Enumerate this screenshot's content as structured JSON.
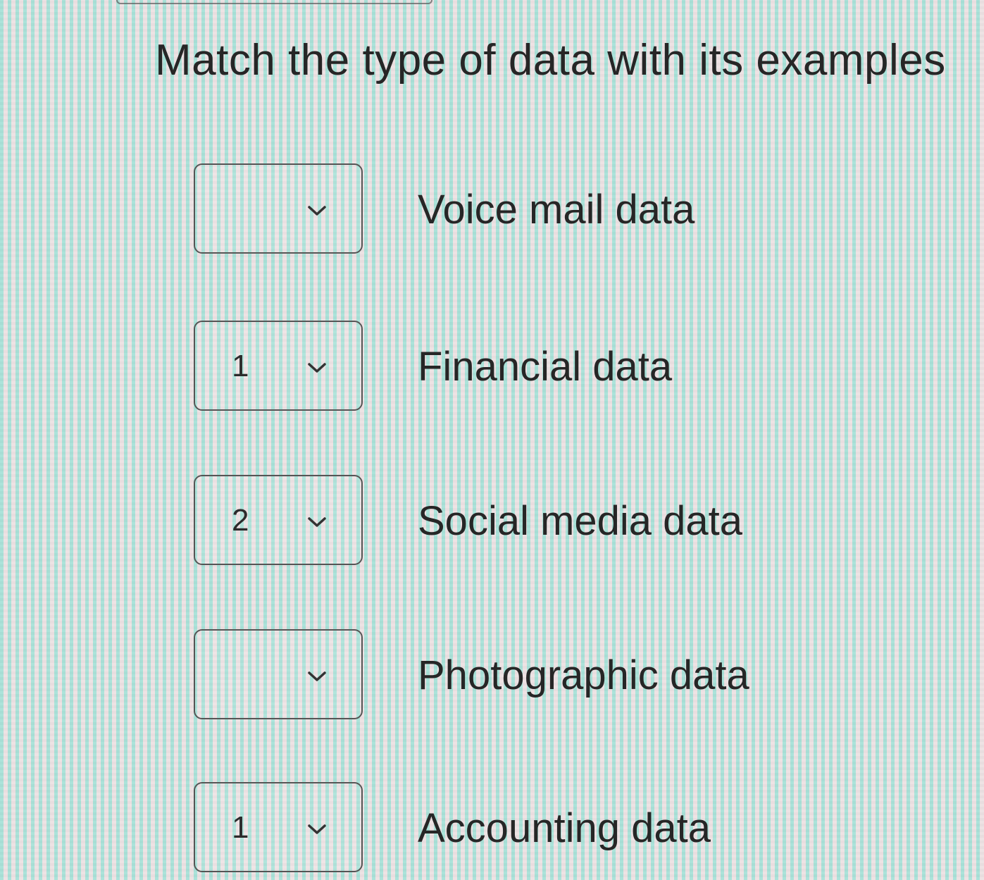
{
  "question": {
    "title": "Match the type of data with its examples"
  },
  "rows": [
    {
      "selected": "",
      "label": "Voice mail data"
    },
    {
      "selected": "1",
      "label": "Financial data"
    },
    {
      "selected": "2",
      "label": "Social media data"
    },
    {
      "selected": "",
      "label": "Photographic data"
    },
    {
      "selected": "1",
      "label": "Accounting data"
    }
  ],
  "icons": {
    "dropdown": "chevron-down-icon"
  }
}
